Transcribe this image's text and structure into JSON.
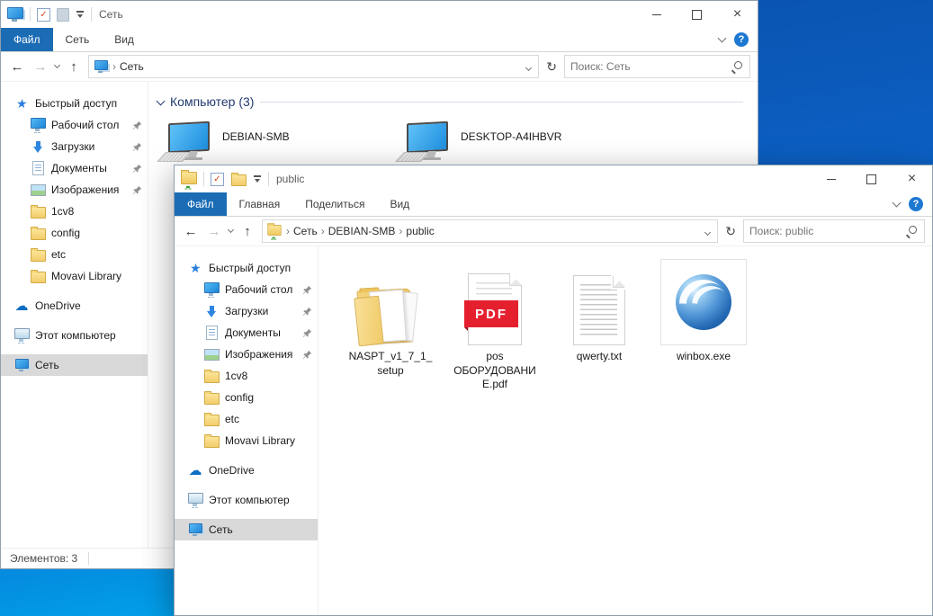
{
  "desktop": {
    "wallpaper_top_color": "#0b5fc2",
    "wallpaper_bottom_color": "#00b6f6"
  },
  "accent": {
    "file_tab_blue": "#1b6cb5",
    "help_blue": "#1d78d2",
    "selection_gray": "#d9d9d9"
  },
  "glyphs": {
    "back_arrow": "←",
    "forward_arrow": "→",
    "up_arrow": "↑",
    "refresh": "↻",
    "minimize": "─",
    "close": "×",
    "help": "?",
    "crumb_separator": "›",
    "quick_access_star": "★",
    "onedrive_cloud": "☁",
    "properties_check": "✓",
    "group_chevron": "∨"
  },
  "sidebar": {
    "items": [
      {
        "label": "Быстрый доступ",
        "icon": "quick-access-star",
        "level": 0
      },
      {
        "label": "Рабочий стол",
        "icon": "desktop-monitor",
        "level": 1,
        "pinned": true
      },
      {
        "label": "Загрузки",
        "icon": "download-arrow",
        "level": 1,
        "pinned": true
      },
      {
        "label": "Документы",
        "icon": "document",
        "level": 1,
        "pinned": true
      },
      {
        "label": "Изображения",
        "icon": "pictures",
        "level": 1,
        "pinned": true
      },
      {
        "label": "1cv8",
        "icon": "folder",
        "level": 1
      },
      {
        "label": "config",
        "icon": "folder",
        "level": 1
      },
      {
        "label": "etc",
        "icon": "folder",
        "level": 1
      },
      {
        "label": "Movavi Library",
        "icon": "folder",
        "level": 1
      },
      {
        "label": "OneDrive",
        "icon": "onedrive-cloud",
        "level": 0,
        "gap": true
      },
      {
        "label": "Этот компьютер",
        "icon": "this-pc-monitor",
        "level": 0,
        "gap": true
      },
      {
        "label": "Сеть",
        "icon": "network-computer",
        "level": 0,
        "gap": true,
        "selected": true
      }
    ]
  },
  "back_window": {
    "title": "Сеть",
    "tabs": [
      {
        "label": "Файл",
        "active": true
      },
      {
        "label": "Сеть",
        "active": false
      },
      {
        "label": "Вид",
        "active": false
      }
    ],
    "address_crumbs": [
      "Сеть"
    ],
    "search_placeholder": "Поиск: Сеть",
    "group_label": "Компьютер (3)",
    "computers": [
      {
        "name": "DEBIAN-SMB"
      },
      {
        "name": "DESKTOP-A4IHBVR"
      }
    ],
    "status_text": "Элементов: 3"
  },
  "front_window": {
    "title": "public",
    "tabs": [
      {
        "label": "Файл",
        "active": true
      },
      {
        "label": "Главная",
        "active": false
      },
      {
        "label": "Поделиться",
        "active": false
      },
      {
        "label": "Вид",
        "active": false
      }
    ],
    "address_crumbs": [
      "Сеть",
      "DEBIAN-SMB",
      "public"
    ],
    "search_placeholder": "Поиск: public",
    "files": [
      {
        "name": "NASPT_v1_7_1_setup",
        "type": "folder-with-docs"
      },
      {
        "name": "pos ОБОРУДОВАНИЕ.pdf",
        "type": "pdf",
        "badge": "PDF"
      },
      {
        "name": "qwerty.txt",
        "type": "txt"
      },
      {
        "name": "winbox.exe",
        "type": "winbox-sphere"
      }
    ]
  }
}
